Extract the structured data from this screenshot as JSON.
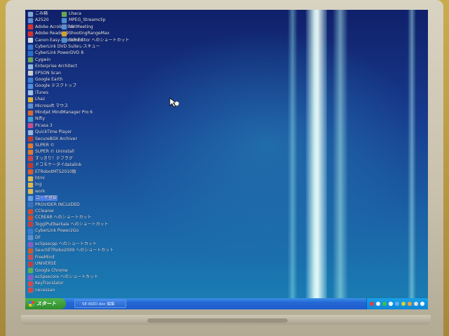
{
  "desktop": {
    "icons": [
      {
        "label": "ごみ箱",
        "color": "#7fa7d6"
      },
      {
        "label": "A2520",
        "color": "#5b8ed1"
      },
      {
        "label": "Adobe Acrobat 5.0",
        "color": "#d8322c"
      },
      {
        "label": "Adobe Reader 9",
        "color": "#d8322c"
      },
      {
        "label": "Canon Easy-PhotoPrint",
        "color": "#cfd6e0"
      },
      {
        "label": "CyberLink DVD Suiteレスキュー",
        "color": "#3478d0"
      },
      {
        "label": "CyberLink PowerDVD 8",
        "color": "#2a6fcc"
      },
      {
        "label": "Cygwin",
        "color": "#6aa84f"
      },
      {
        "label": "Enterprise Architect",
        "color": "#8fb7e0"
      },
      {
        "label": "EPSON Scan",
        "color": "#cccccc"
      },
      {
        "label": "Google Earth",
        "color": "#3f7fd3"
      },
      {
        "label": "Google デスクトップ",
        "color": "#4f8fe0"
      },
      {
        "label": "iTunes",
        "color": "#9fc1e6"
      },
      {
        "label": "Lhaz",
        "color": "#e0b030"
      },
      {
        "label": "Microsoft マウス",
        "color": "#5c8fd0"
      },
      {
        "label": "Mindjet MindManager Pro 6",
        "color": "#d86a2a"
      },
      {
        "label": "Nifty",
        "color": "#3fa0d0"
      },
      {
        "label": "Picasa 3",
        "color": "#d04a8a"
      },
      {
        "label": "QuickTime Player",
        "color": "#9ab6d8"
      },
      {
        "label": "SecureBOX Archiver",
        "color": "#c0392b"
      },
      {
        "label": "SUPER ©",
        "color": "#e07a2a"
      },
      {
        "label": "SUPER © Uninstall",
        "color": "#e07a2a"
      },
      {
        "label": "すっきり！デフラグ",
        "color": "#d04040"
      },
      {
        "label": "ドコモケータイdatalink",
        "color": "#c0392b"
      },
      {
        "label": "ETRobotMTS2010版",
        "color": "#e05a2a"
      },
      {
        "label": "html",
        "color": "#e0b84a"
      },
      {
        "label": "lng",
        "color": "#e0b84a"
      },
      {
        "label": "work",
        "color": "#e0b84a"
      },
      {
        "label": "ユーザ登録",
        "color": "#6a9fe0",
        "selected": true
      },
      {
        "label": "PROVIDER INCLUDED",
        "color": "#3b6fc0"
      },
      {
        "label": "CCleaner",
        "color": "#d04a2a"
      },
      {
        "label": "CCREAR へのショートカット",
        "color": "#d04a2a"
      },
      {
        "label": "TogglPullbarkaie へのショートカット",
        "color": "#c04040"
      },
      {
        "label": "CyberLink Power2Go",
        "color": "#3a7ad0"
      },
      {
        "label": "DF",
        "color": "#5b8ed1"
      },
      {
        "label": "eclipsecpp へのショートカット",
        "color": "#8a5ac0"
      },
      {
        "label": "SeuchETRobo2009 へのショートカット",
        "color": "#d05a2a"
      },
      {
        "label": "FreeMind",
        "color": "#d04a4a"
      },
      {
        "label": "UNIVERSE",
        "color": "#c04040"
      },
      {
        "label": "Google Chrome",
        "color": "#5fae4f"
      },
      {
        "label": "eclipsecore へのショートカット",
        "color": "#8a5ac0"
      },
      {
        "label": "KeyTranslator",
        "color": "#d04a4a"
      },
      {
        "label": "necessao",
        "color": "#d04a4a"
      }
    ],
    "column2": [
      {
        "label": "Lhaca",
        "color": "#6aa84f"
      },
      {
        "label": "MPEG_Streamclip",
        "color": "#4a8fd0"
      },
      {
        "label": "NetMeeting",
        "color": "#5b8ed1"
      },
      {
        "label": "ShootingRangeMax",
        "color": "#d0a030"
      },
      {
        "label": "SkinEditor へのショートカット",
        "color": "#4a8fd0"
      }
    ]
  },
  "taskbar": {
    "start_label": "スタート",
    "task_label": "SE-WZD.doc 編集",
    "tray_colors": [
      "#e04040",
      "#f0f0f0",
      "#40c040",
      "#ffffff",
      "#60b0f0",
      "#d0d040",
      "#f0a030",
      "#e0e0e0",
      "#ffffff"
    ]
  }
}
